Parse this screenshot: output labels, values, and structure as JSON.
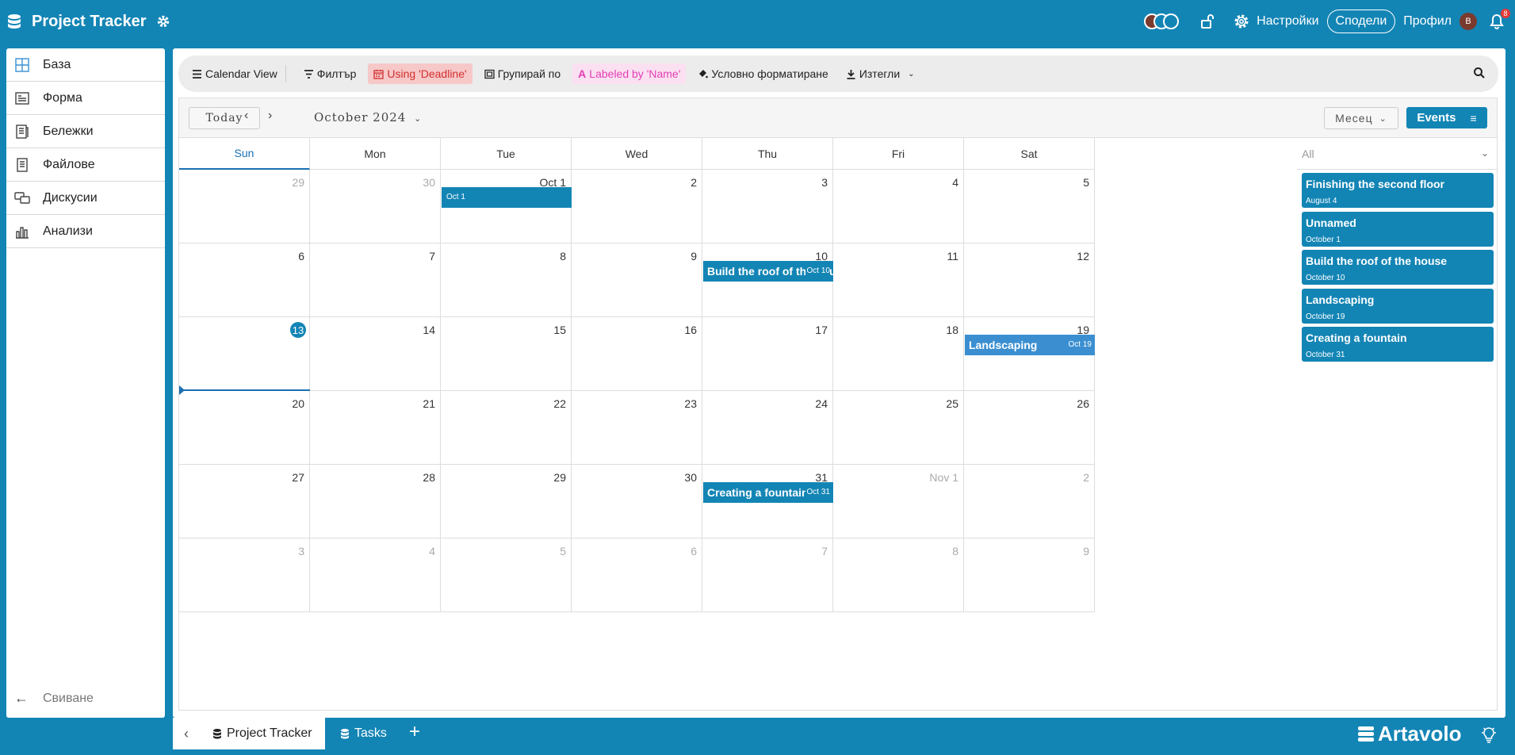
{
  "app": {
    "title": "Project Tracker",
    "colors": {
      "primary": "#1385b5",
      "event_alt": "#3b8fd1",
      "deadline_bg": "#f7c8c8",
      "deadline_fg": "#d32f2f",
      "label_bg": "#fbe0f1",
      "label_fg": "#e33fb4"
    }
  },
  "topbar": {
    "settings_label": "Настройки",
    "share_label": "Сподели",
    "profile_label": "Профил",
    "avatar_initial": "В",
    "notification_count": "8"
  },
  "sidebar": {
    "items": [
      {
        "label": "База",
        "icon": "grid-icon"
      },
      {
        "label": "Форма",
        "icon": "form-icon"
      },
      {
        "label": "Бележки",
        "icon": "notes-icon"
      },
      {
        "label": "Файлове",
        "icon": "files-icon"
      },
      {
        "label": "Дискусии",
        "icon": "chat-icon"
      },
      {
        "label": "Анализи",
        "icon": "chart-icon"
      }
    ],
    "collapse_label": "Свиване"
  },
  "toolbar": {
    "calendar_view": "Calendar View",
    "filter": "Филтър",
    "using_deadline": "Using 'Deadline'",
    "group_by": "Групирай по",
    "labeled_by": "Labeled by 'Name'",
    "conditional_format": "Условно форматиране",
    "downloads": "Изтегли"
  },
  "calendar": {
    "today_label": "Today",
    "month_label": "October 2024",
    "view_select": "Месец",
    "events_button": "Events",
    "filter_label": "All",
    "weekdays": [
      "Sun",
      "Mon",
      "Tue",
      "Wed",
      "Thu",
      "Fri",
      "Sat"
    ],
    "weeks": [
      [
        {
          "n": "29",
          "m": true
        },
        {
          "n": "30",
          "m": true
        },
        {
          "n": "Oct 1"
        },
        {
          "n": "2"
        },
        {
          "n": "3"
        },
        {
          "n": "4"
        },
        {
          "n": "5"
        }
      ],
      [
        {
          "n": "6"
        },
        {
          "n": "7"
        },
        {
          "n": "8"
        },
        {
          "n": "9"
        },
        {
          "n": "10"
        },
        {
          "n": "11"
        },
        {
          "n": "12"
        }
      ],
      [
        {
          "n": "13",
          "today": true
        },
        {
          "n": "14"
        },
        {
          "n": "15"
        },
        {
          "n": "16"
        },
        {
          "n": "17"
        },
        {
          "n": "18"
        },
        {
          "n": "19"
        }
      ],
      [
        {
          "n": "20"
        },
        {
          "n": "21"
        },
        {
          "n": "22"
        },
        {
          "n": "23"
        },
        {
          "n": "24"
        },
        {
          "n": "25"
        },
        {
          "n": "26"
        }
      ],
      [
        {
          "n": "27"
        },
        {
          "n": "28"
        },
        {
          "n": "29"
        },
        {
          "n": "30"
        },
        {
          "n": "31"
        },
        {
          "n": "Nov 1",
          "m": true
        },
        {
          "n": "2",
          "m": true
        }
      ],
      [
        {
          "n": "3",
          "m": true
        },
        {
          "n": "4",
          "m": true
        },
        {
          "n": "5",
          "m": true
        },
        {
          "n": "6",
          "m": true
        },
        {
          "n": "7",
          "m": true
        },
        {
          "n": "8",
          "m": true
        },
        {
          "n": "9",
          "m": true
        }
      ]
    ],
    "events": [
      {
        "week": 0,
        "day": 2,
        "title": "",
        "date": "Oct 1",
        "alt": false
      },
      {
        "week": 1,
        "day": 4,
        "title": "Build the roof of the house",
        "date": "Oct 10",
        "alt": false
      },
      {
        "week": 2,
        "day": 6,
        "title": "Landscaping",
        "date": "Oct 19",
        "alt": true
      },
      {
        "week": 4,
        "day": 4,
        "title": "Creating a fountain",
        "date": "Oct 31",
        "alt": false
      }
    ],
    "side_events": [
      {
        "title": "Finishing the second floor",
        "date": "August 4"
      },
      {
        "title": "Unnamed",
        "date": "October 1"
      },
      {
        "title": "Build the roof of the house",
        "date": "October 10"
      },
      {
        "title": "Landscaping",
        "date": "October 19"
      },
      {
        "title": "Creating a fountain",
        "date": "October 31"
      }
    ]
  },
  "bottom": {
    "tabs": [
      {
        "label": "Project Tracker",
        "active": true
      },
      {
        "label": "Tasks",
        "active": false
      }
    ],
    "brand": "Artavolo"
  }
}
